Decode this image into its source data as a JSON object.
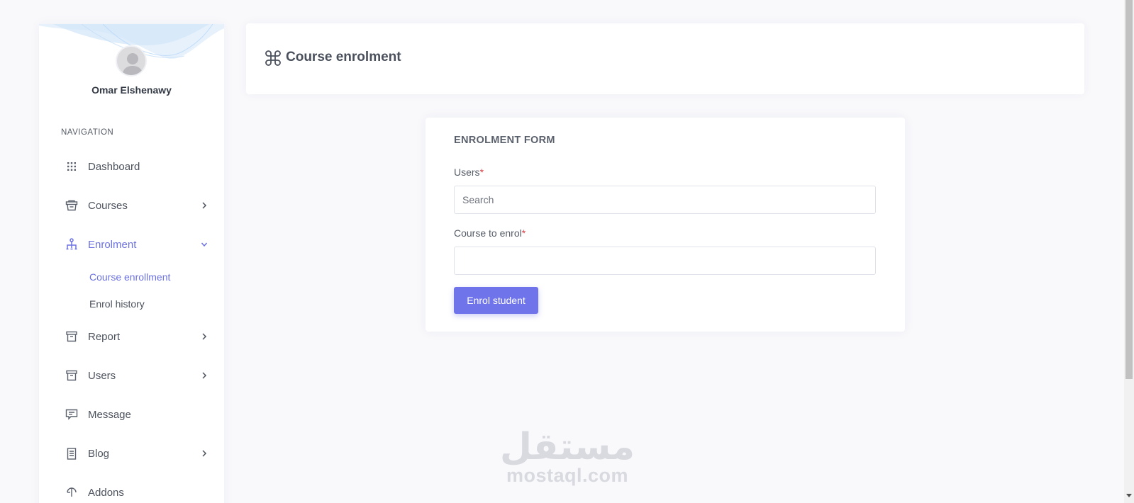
{
  "sidebar": {
    "user_name": "Omar Elshenawy",
    "nav_heading": "NAVIGATION",
    "items": [
      {
        "label": "Dashboard",
        "icon": "grid-dots-icon"
      },
      {
        "label": "Courses",
        "icon": "basket-icon"
      },
      {
        "label": "Enrolment",
        "icon": "sitemap-icon"
      },
      {
        "label": "Report",
        "icon": "archive-icon"
      },
      {
        "label": "Users",
        "icon": "archive-icon"
      },
      {
        "label": "Message",
        "icon": "message-icon"
      },
      {
        "label": "Blog",
        "icon": "document-icon"
      },
      {
        "label": "Addons",
        "icon": "addons-icon"
      }
    ],
    "enrolment_sub": [
      {
        "label": "Course enrollment"
      },
      {
        "label": "Enrol history"
      }
    ]
  },
  "header": {
    "title": "Course enrolment",
    "icon": "command-icon"
  },
  "form": {
    "title": "ENROLMENT FORM",
    "users_label": "Users",
    "users_placeholder": "Search",
    "course_label": "Course to enrol",
    "course_value": "",
    "required_mark": "*",
    "submit_label": "Enrol student"
  },
  "watermark": {
    "arabic": "مستقل",
    "latin": "mostaql.com"
  },
  "colors": {
    "accent": "#6f74ea",
    "active_text": "#6c72e0",
    "required": "#e0424a",
    "background": "#f9f9fc"
  }
}
